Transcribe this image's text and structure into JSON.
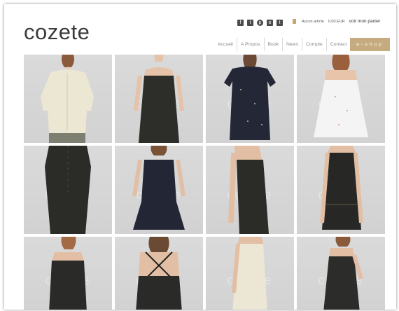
{
  "header": {
    "logo": "cozete",
    "social_icons": [
      "facebook-icon",
      "twitter-icon",
      "pinterest-icon",
      "instagram-icon",
      "tumblr-icon"
    ],
    "social_glyphs": [
      "f",
      "t",
      "p",
      "o",
      "t"
    ],
    "cart": {
      "items_text": "Aucun article",
      "amount": "0,00 EUR",
      "link": "voir mon panier"
    }
  },
  "nav": {
    "items": [
      "Accueil",
      "A Propos",
      "Book",
      "News",
      "Compte",
      "Contact"
    ],
    "eshop": "e-shop"
  },
  "grid": {
    "watermark": "cozete",
    "products": [
      {
        "name": "cream-blouse"
      },
      {
        "name": "black-strap-dress"
      },
      {
        "name": "navy-print-tshirt-dress"
      },
      {
        "name": "white-print-camisole"
      },
      {
        "name": "black-button-dress"
      },
      {
        "name": "navy-print-tiered-dress"
      },
      {
        "name": "black-tank-dress"
      },
      {
        "name": "black-shift-dress"
      },
      {
        "name": "black-slip-dress"
      },
      {
        "name": "black-crossback-dress"
      },
      {
        "name": "cream-skirt"
      },
      {
        "name": "black-scoop-dress"
      }
    ]
  },
  "colors": {
    "accent": "#c7ab80",
    "logo": "#3a3a3a",
    "tile_bg": "#d9d9d9"
  }
}
